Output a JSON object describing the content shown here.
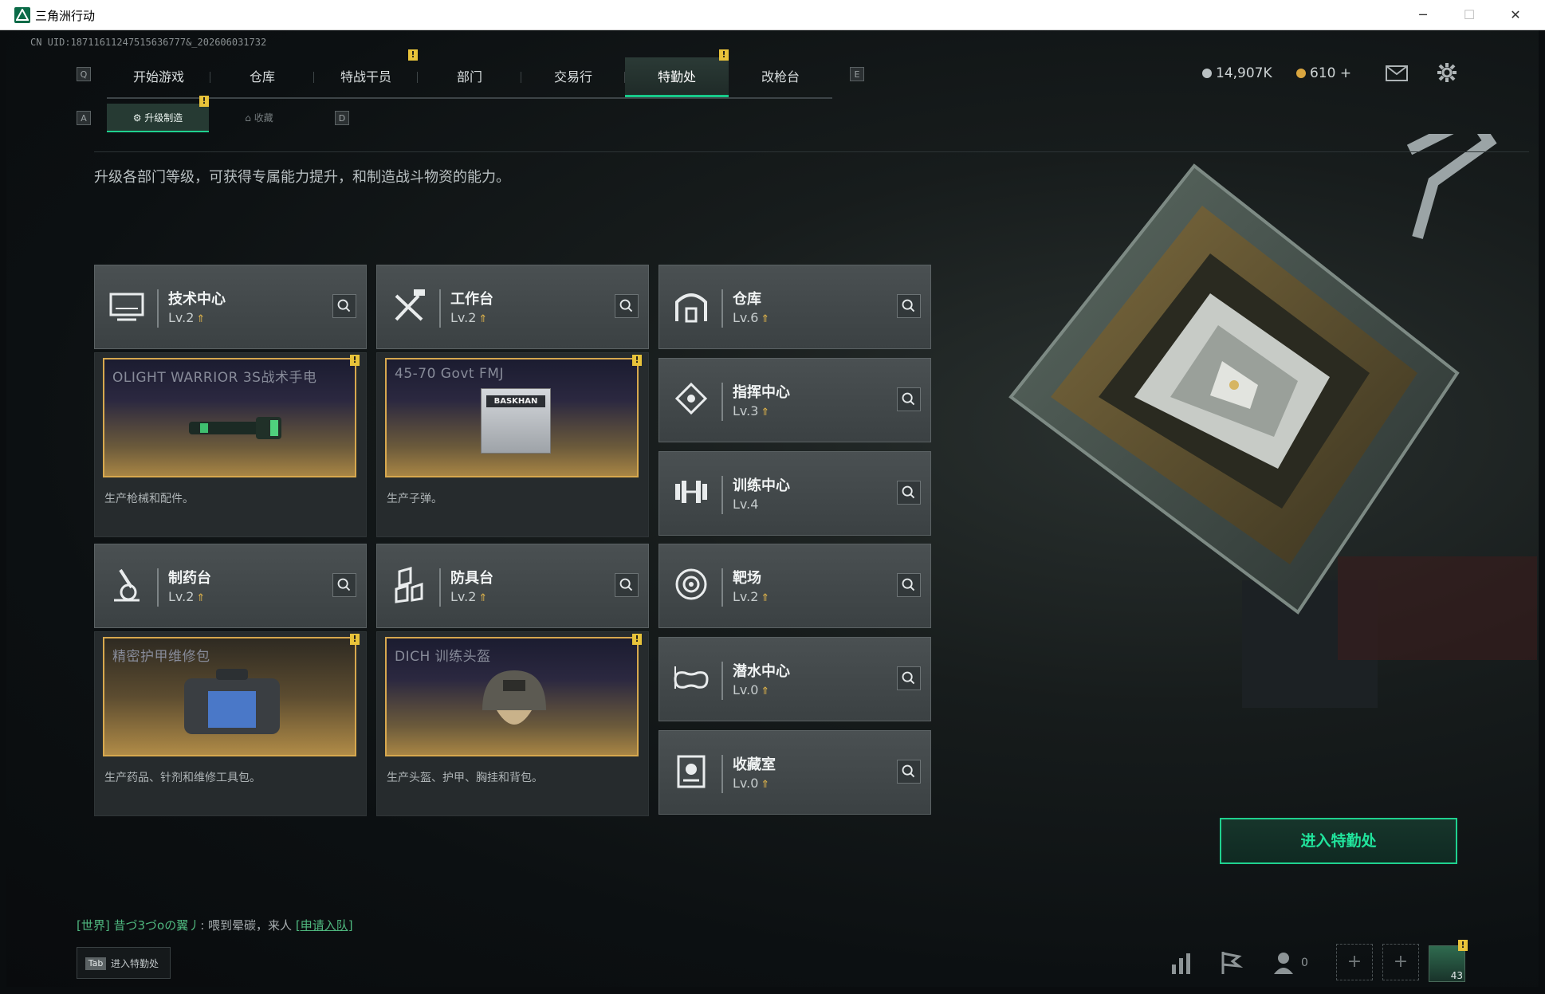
{
  "window": {
    "title": "三角洲行动",
    "minimize": "─",
    "maximize": "☐",
    "close": "✕"
  },
  "uid": "CN UID:18711611247515636777&_202606031732",
  "nav": {
    "key_left": "Q",
    "key_right": "E",
    "tabs": [
      "开始游戏",
      "仓库",
      "特战干员",
      "部门",
      "交易行",
      "特勤处",
      "改枪台"
    ],
    "active": "特勤处"
  },
  "currency": {
    "silver": "14,907K",
    "gold": "610",
    "plus": "+"
  },
  "subnav": {
    "key_left": "A",
    "key_right": "D",
    "tabs": [
      "升级制造",
      "收藏"
    ],
    "active": "升级制造"
  },
  "description": "升级各部门等级，可获得专属能力提升，和制造战斗物资的能力。",
  "stations": [
    {
      "name": "技术中心",
      "level": "Lv.2",
      "icon": "computer-icon",
      "upgradable": true
    },
    {
      "name": "工作台",
      "level": "Lv.2",
      "icon": "tools-icon",
      "upgradable": true
    },
    {
      "name": "仓库",
      "level": "Lv.6",
      "icon": "warehouse-icon",
      "upgradable": true
    },
    {
      "name": "指挥中心",
      "level": "Lv.3",
      "icon": "command-icon",
      "upgradable": true
    },
    {
      "name": "训练中心",
      "level": "Lv.4",
      "icon": "dumbbell-icon",
      "upgradable": false
    },
    {
      "name": "制药台",
      "level": "Lv.2",
      "icon": "microscope-icon",
      "upgradable": true
    },
    {
      "name": "防具台",
      "level": "Lv.2",
      "icon": "armor-icon",
      "upgradable": true
    },
    {
      "name": "靶场",
      "level": "Lv.2",
      "icon": "target-icon",
      "upgradable": true
    },
    {
      "name": "潜水中心",
      "level": "Lv.0",
      "icon": "goggles-icon",
      "upgradable": true
    },
    {
      "name": "收藏室",
      "level": "Lv.0",
      "icon": "collection-icon",
      "upgradable": true
    }
  ],
  "production": [
    {
      "item": "OLIGHT WARRIOR 3S战术手电",
      "desc": "生产枪械和配件。",
      "icon": "flashlight-icon"
    },
    {
      "item": "45-70 Govt FMJ",
      "desc": "生产子弹。",
      "icon": "ammo-box-icon",
      "box_label": "BASKHAN"
    },
    {
      "item": "精密护甲维修包",
      "desc": "生产药品、针剂和维修工具包。",
      "icon": "repair-kit-icon"
    },
    {
      "item": "DICH 训练头盔",
      "desc": "生产头盔、护甲、胸挂和背包。",
      "icon": "helmet-icon"
    }
  ],
  "badge_mark": "!",
  "enter_button": "进入特勤处",
  "chat": {
    "channel": "[世界]",
    "user": "昔づ3づoの翼丿",
    "message": ": 喂到晕碳，来人",
    "link": "[申请入队]"
  },
  "tab_hint": {
    "key": "Tab",
    "label": "进入特勤处"
  },
  "friends_count": "0",
  "avatar_level": "43",
  "colors": {
    "accent": "#1fd18f",
    "badge": "#e8c33a",
    "highlight_frame": "#d7a84e"
  }
}
